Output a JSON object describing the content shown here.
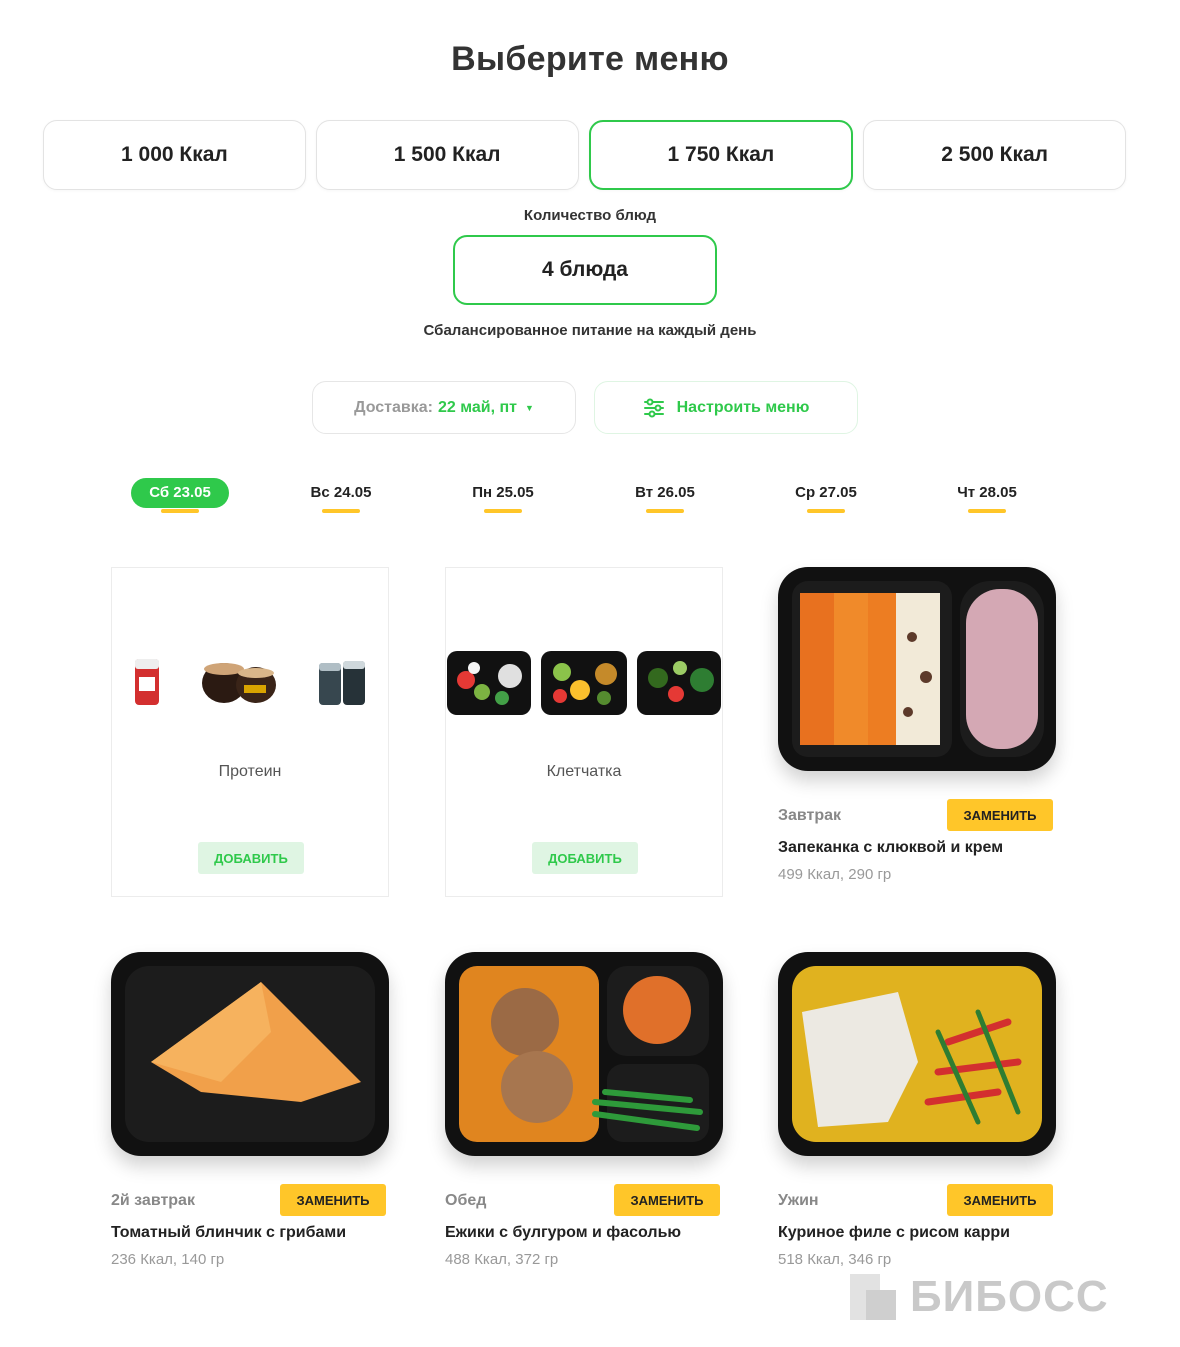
{
  "page": {
    "title": "Выберите меню"
  },
  "calorie_options": [
    {
      "label": "1 000 Ккал",
      "selected": false
    },
    {
      "label": "1 500 Ккал",
      "selected": false
    },
    {
      "label": "1 750 Ккал",
      "selected": true
    },
    {
      "label": "2 500 Ккал",
      "selected": false
    }
  ],
  "dishes_count": {
    "label": "Количество блюд",
    "value": "4 блюда"
  },
  "tagline": "Сбалансированное питание на каждый день",
  "delivery": {
    "label": "Доставка:",
    "value": "22 май, пт",
    "caret_icon": "caret-down-icon"
  },
  "customize": {
    "label": "Настроить меню",
    "icon": "sliders-icon"
  },
  "days": [
    {
      "label": "Сб 23.05",
      "active": true
    },
    {
      "label": "Вс 24.05",
      "active": false
    },
    {
      "label": "Пн 25.05",
      "active": false
    },
    {
      "label": "Вт 26.05",
      "active": false
    },
    {
      "label": "Ср 27.05",
      "active": false
    },
    {
      "label": "Чт 28.05",
      "active": false
    }
  ],
  "addons": [
    {
      "name": "Протеин",
      "button": "ДОБАВИТЬ"
    },
    {
      "name": "Клетчатка",
      "button": "ДОБАВИТЬ"
    }
  ],
  "meals": [
    {
      "meal": "Завтрак",
      "name": "Запеканка с клюквой и крем",
      "nutrition": "499 Ккал, 290 гр",
      "button": "ЗАМЕНИТЬ"
    },
    {
      "meal": "2й завтрак",
      "name": "Томатный блинчик с грибами",
      "nutrition": "236 Ккал, 140 гр",
      "button": "ЗАМЕНИТЬ"
    },
    {
      "meal": "Обед",
      "name": "Ежики с булгуром и фасолью",
      "nutrition": "488 Ккал, 372 гр",
      "button": "ЗАМЕНИТЬ"
    },
    {
      "meal": "Ужин",
      "name": "Куриное филе с рисом карри",
      "nutrition": "518 Ккал, 346 гр",
      "button": "ЗАМЕНИТЬ"
    }
  ],
  "watermark": {
    "text": "БИБОСС"
  },
  "colors": {
    "accent": "#2fc94b",
    "replace": "#ffc629",
    "add_bg": "#dff5e3"
  }
}
